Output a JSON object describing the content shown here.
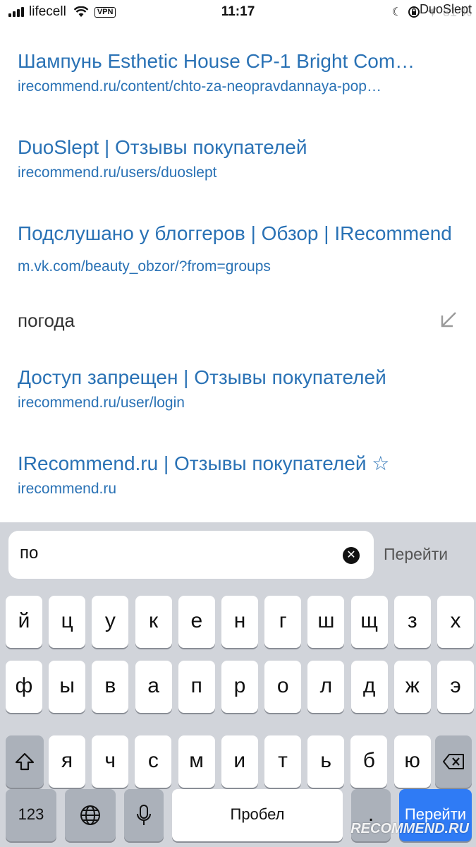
{
  "status_bar": {
    "carrier": "lifecell",
    "vpn": "VPN",
    "time": "11:17",
    "battery_text": "81 %",
    "watermark": "DuoSlept",
    "icons": [
      "signal-icon",
      "wifi-icon",
      "moon-icon",
      "rotation-lock-icon",
      "location-arrow-icon"
    ]
  },
  "suggestions": [
    {
      "title": "Шампунь Esthetic House CP-1 Bright Com…",
      "url": "irecommend.ru/content/chto-za-neopravdannaya-pop…"
    },
    {
      "title": "DuoSlept | Отзывы покупателей",
      "url": "irecommend.ru/users/duoslept"
    },
    {
      "title": "Подслушано у блоггеров | Обзор | IRecommend",
      "url": "m.vk.com/beauty_obzor/?from=groups"
    },
    {
      "title": "Доступ запрещен | Отзывы покупателей",
      "url": "irecommend.ru/user/login"
    },
    {
      "title": "IRecommend.ru | Отзывы покупателей ☆",
      "url": "irecommend.ru"
    }
  ],
  "query_suggestion": {
    "text": "погода",
    "icon": "fill-arrow-icon"
  },
  "address_bar": {
    "value": "по",
    "go_label": "Перейти"
  },
  "keyboard": {
    "row1": [
      "й",
      "ц",
      "у",
      "к",
      "е",
      "н",
      "г",
      "ш",
      "щ",
      "з",
      "х"
    ],
    "row2": [
      "ф",
      "ы",
      "в",
      "а",
      "п",
      "р",
      "о",
      "л",
      "д",
      "ж",
      "э"
    ],
    "row3": [
      "я",
      "ч",
      "с",
      "м",
      "и",
      "т",
      "ь",
      "б",
      "ю"
    ],
    "numbers_label": "123",
    "space_label": "Пробел",
    "dot_label": ".",
    "go_label": "Перейти"
  },
  "watermark_bottom": "RECOMMEND.RU",
  "colors": {
    "link": "#2a72b5",
    "keyboard_bg": "#d1d4da",
    "go_key": "#2f7bf5"
  }
}
